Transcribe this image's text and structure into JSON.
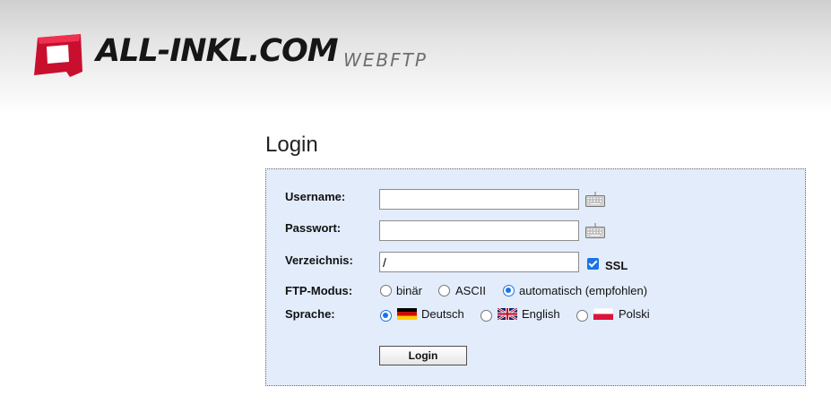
{
  "header": {
    "brand": "ALL-INKL.COM",
    "subbrand": "WEBFTP",
    "brand_color": "#e3002d"
  },
  "login": {
    "title": "Login",
    "username_label": "Username:",
    "username_value": "",
    "password_label": "Passwort:",
    "password_value": "",
    "directory_label": "Verzeichnis:",
    "directory_value": "/",
    "ssl_label": "SSL",
    "ssl_checked": true,
    "ftp_mode_label": "FTP-Modus:",
    "ftp_modes": [
      {
        "label": "binär",
        "selected": false
      },
      {
        "label": "ASCII",
        "selected": false
      },
      {
        "label": "automatisch (empfohlen)",
        "selected": true
      }
    ],
    "language_label": "Sprache:",
    "languages": [
      {
        "label": "Deutsch",
        "flag": "germany-flag",
        "selected": true
      },
      {
        "label": "English",
        "flag": "uk-flag",
        "selected": false
      },
      {
        "label": "Polski",
        "flag": "poland-flag",
        "selected": false
      }
    ],
    "keyboard_icon": "virtual-keyboard-icon",
    "submit_label": "Login",
    "accent_color": "#1a73e8",
    "panel_color": "#e3ecfb"
  }
}
